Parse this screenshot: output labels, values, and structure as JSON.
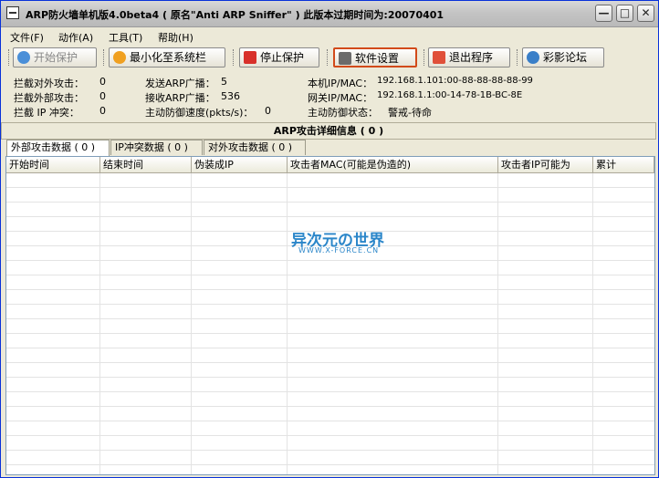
{
  "window": {
    "title": "ARP防火墙单机版4.0beta4 ( 原名\"Anti ARP Sniffer\" ) 此版本过期时间为:20070401",
    "min_glyph": "—",
    "max_glyph": "□",
    "close_glyph": "✕"
  },
  "menu": [
    "文件(F)",
    "动作(A)",
    "工具(T)",
    "帮助(H)"
  ],
  "toolbar": {
    "start": "开始保护",
    "minimize": "最小化至系统栏",
    "stop": "停止保护",
    "settings": "软件设置",
    "exit": "退出程序",
    "forum": "彩影论坛"
  },
  "stats": {
    "block_outbound_label": "拦截对外攻击：",
    "block_outbound_value": "0",
    "block_inbound_label": "拦截外部攻击：",
    "block_inbound_value": "0",
    "block_ip_label": "拦截 IP 冲突：",
    "block_ip_value": "0",
    "send_arp_label": "发送ARP广播：",
    "send_arp_value": "5",
    "recv_arp_label": "接收ARP广播：",
    "recv_arp_value": "536",
    "speed_label": "主动防御速度(pkts/s)：",
    "speed_value": "0",
    "local_label": "本机IP/MAC：",
    "local_value": "192.168.1.101:00-88-88-88-88-99",
    "gateway_label": "网关IP/MAC：",
    "gateway_value": "192.168.1.1:00-14-78-1B-BC-8E",
    "status_label": "主动防御状态：",
    "status_value": "警戒-待命"
  },
  "section_title": "ARP攻击详细信息 ( 0 )",
  "tabs": [
    "外部攻击数据 ( 0 )",
    "IP冲突数据 ( 0 )",
    "对外攻击数据 ( 0 )"
  ],
  "columns": [
    "开始时间",
    "结束时间",
    "伪装成IP",
    "攻击者MAC(可能是伪造的)",
    "攻击者IP可能为",
    "累计"
  ],
  "watermark": {
    "main": "异次元の世界",
    "sub": "WWW.X-FORCE.CN"
  },
  "colors": {
    "accent_blue": "#2b86c9",
    "stop_red": "#d8302a",
    "start_blue": "#4a8fd8",
    "min_orange": "#f0a020"
  }
}
